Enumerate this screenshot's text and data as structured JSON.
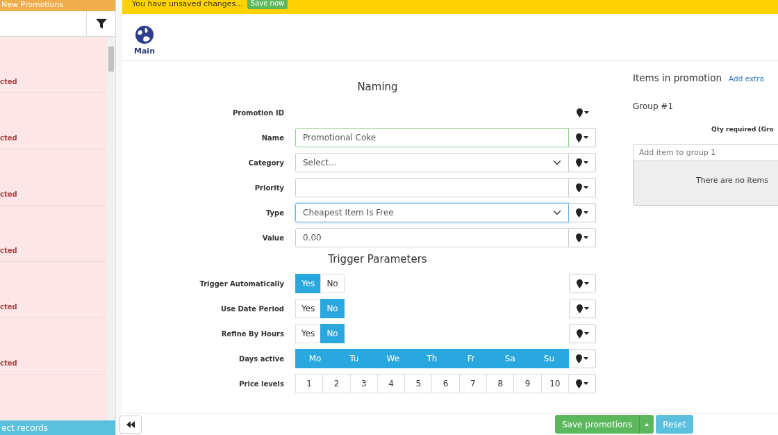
{
  "sidebar": {
    "title": "New Promotions",
    "rows": [
      {
        "status": "cted"
      },
      {
        "status": "cted"
      },
      {
        "status": "cted"
      },
      {
        "status": "cted"
      },
      {
        "status": "cted"
      },
      {
        "status": "cted"
      }
    ],
    "footer_button": "ect records"
  },
  "banner": {
    "message": "You have unsaved changes...",
    "button": "Save now"
  },
  "tabs": [
    {
      "label": "Main",
      "selected": true
    }
  ],
  "naming": {
    "heading": "Naming",
    "fields": [
      {
        "kind": "static",
        "label": "Promotion ID"
      },
      {
        "kind": "text",
        "label": "Name",
        "value": "Promotional Coke",
        "valid": true
      },
      {
        "kind": "select",
        "label": "Category",
        "value": "Select..."
      },
      {
        "kind": "text",
        "label": "Priority"
      },
      {
        "kind": "select",
        "label": "Type",
        "value": "Cheapest Item Is Free",
        "focused": true
      },
      {
        "kind": "text",
        "label": "Value",
        "value": "0.00"
      }
    ]
  },
  "trigger": {
    "heading": "Trigger Parameters",
    "fields": [
      {
        "kind": "toggle",
        "label": "Trigger Automatically",
        "options": [
          {
            "label": "Yes",
            "selected": true
          },
          {
            "label": "No",
            "selected": false
          }
        ]
      },
      {
        "kind": "toggle",
        "label": "Use Date Period",
        "options": [
          {
            "label": "Yes",
            "selected": false
          },
          {
            "label": "No",
            "selected": true
          }
        ]
      },
      {
        "kind": "toggle",
        "label": "Refine By Hours",
        "options": [
          {
            "label": "Yes",
            "selected": false
          },
          {
            "label": "No",
            "selected": true
          }
        ]
      },
      {
        "kind": "multi",
        "label": "Days active",
        "options": [
          {
            "label": "Mo",
            "selected": true
          },
          {
            "label": "Tu",
            "selected": true
          },
          {
            "label": "We",
            "selected": true
          },
          {
            "label": "Th",
            "selected": true
          },
          {
            "label": "Fr",
            "selected": true
          },
          {
            "label": "Sa",
            "selected": true
          },
          {
            "label": "Su",
            "selected": true
          }
        ]
      },
      {
        "kind": "multi",
        "label": "Price levels",
        "options": [
          {
            "label": "1",
            "selected": false
          },
          {
            "label": "2",
            "selected": false
          },
          {
            "label": "3",
            "selected": false
          },
          {
            "label": "4",
            "selected": false
          },
          {
            "label": "5",
            "selected": false
          },
          {
            "label": "6",
            "selected": false
          },
          {
            "label": "7",
            "selected": false
          },
          {
            "label": "8",
            "selected": false
          },
          {
            "label": "9",
            "selected": false
          },
          {
            "label": "10",
            "selected": false
          }
        ]
      }
    ]
  },
  "items": {
    "heading": "Items in promotion",
    "add_link": "Add extra",
    "groups": [
      {
        "title": "Group #1",
        "qty_label": "Qty required (Gro",
        "placeholder": "Add item to group 1",
        "empty_text": "There are no items"
      }
    ]
  },
  "footer": {
    "save": "Save promotions",
    "reset": "Reset"
  }
}
